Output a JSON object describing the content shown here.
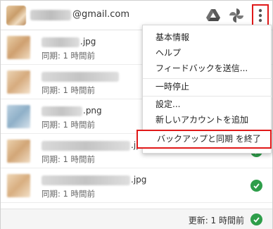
{
  "header": {
    "email_suffix": "@gmail.com",
    "icons": [
      "google-drive-icon",
      "google-photos-icon",
      "more-vert-icon"
    ]
  },
  "files": [
    {
      "ext": ".jpg",
      "sync": "同期: 1 時間前",
      "status": "synced"
    },
    {
      "ext": "",
      "sync": "同期: 1 時間前",
      "status": "synced"
    },
    {
      "ext": ".png",
      "sync": "同期: 1 時間前",
      "status": "synced"
    },
    {
      "ext": ".jpg",
      "sync": "同期: 1 時間前",
      "status": "synced"
    },
    {
      "ext": ".jpg",
      "sync": "同期: 1 時間前",
      "status": "synced"
    }
  ],
  "footer": {
    "updated": "更新: 1 時間前"
  },
  "menu": {
    "items": [
      "基本情報",
      "ヘルプ",
      "フィードバックを送信...",
      "一時停止",
      "設定...",
      "新しいアカウントを追加",
      "バックアップと同期 を終了"
    ]
  },
  "colors": {
    "highlight": "#e01919",
    "check_green": "#2e9e4a"
  }
}
